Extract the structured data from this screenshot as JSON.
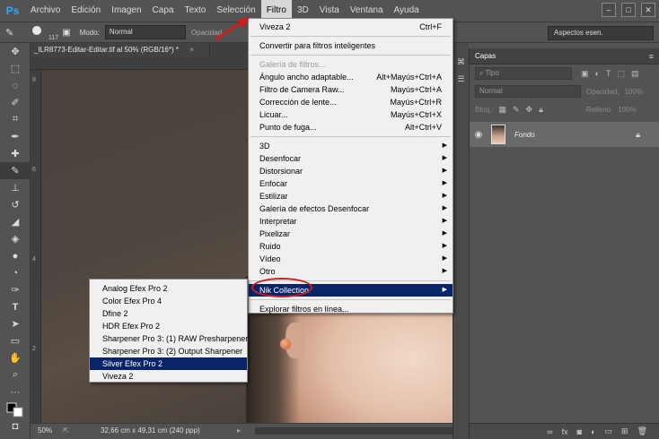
{
  "menubar": {
    "logo": "Ps",
    "items": [
      "Archivo",
      "Edición",
      "Imagen",
      "Capa",
      "Texto",
      "Selección",
      "Filtro",
      "3D",
      "Vista",
      "Ventana",
      "Ayuda"
    ],
    "active": "Filtro"
  },
  "options": {
    "brush_size": "117",
    "mode_label": "Modo:",
    "mode_value": "Normal",
    "opacity_label": "Opacidad",
    "workspace": "Aspectos esen."
  },
  "document": {
    "tab_title": "_ILR8773-Editar-Editar.tif al 50% (RGB/16*) *",
    "close": "×",
    "zoom": "50%",
    "info": "32,66 cm x 49,31 cm (240 ppp)",
    "ruler_marks": [
      "8",
      "6",
      "4",
      "2"
    ]
  },
  "filter_menu": {
    "items": [
      {
        "label": "Viveza 2",
        "shortcut": "Ctrl+F"
      },
      {
        "sep": true
      },
      {
        "label": "Convertir para filtros inteligentes"
      },
      {
        "sep": true
      },
      {
        "label": "Galería de filtros...",
        "disabled": true
      },
      {
        "label": "Ángulo ancho adaptable...",
        "shortcut": "Alt+Mayús+Ctrl+A"
      },
      {
        "label": "Filtro de Camera Raw...",
        "shortcut": "Mayús+Ctrl+A"
      },
      {
        "label": "Corrección de lente...",
        "shortcut": "Mayús+Ctrl+R"
      },
      {
        "label": "Licuar...",
        "shortcut": "Mayús+Ctrl+X"
      },
      {
        "label": "Punto de fuga...",
        "shortcut": "Alt+Ctrl+V"
      },
      {
        "sep": true
      },
      {
        "label": "3D",
        "submenu": true
      },
      {
        "label": "Desenfocar",
        "submenu": true
      },
      {
        "label": "Distorsionar",
        "submenu": true
      },
      {
        "label": "Enfocar",
        "submenu": true
      },
      {
        "label": "Estilizar",
        "submenu": true
      },
      {
        "label": "Galería de efectos Desenfocar",
        "submenu": true
      },
      {
        "label": "Interpretar",
        "submenu": true
      },
      {
        "label": "Pixelizar",
        "submenu": true
      },
      {
        "label": "Ruido",
        "submenu": true
      },
      {
        "label": "Vídeo",
        "submenu": true
      },
      {
        "label": "Otro",
        "submenu": true
      },
      {
        "sep": true
      },
      {
        "label": "Nik Collection",
        "submenu": true,
        "highlighted": true
      },
      {
        "sep": true
      },
      {
        "label": "Explorar filtros en línea..."
      }
    ]
  },
  "nik_submenu": {
    "items": [
      {
        "label": "Analog Efex Pro 2"
      },
      {
        "label": "Color Efex Pro 4"
      },
      {
        "label": "Dfine 2"
      },
      {
        "label": "HDR Efex Pro 2"
      },
      {
        "label": "Sharpener Pro 3: (1) RAW Presharpener"
      },
      {
        "label": "Sharpener Pro 3: (2) Output Sharpener"
      },
      {
        "label": "Silver Efex Pro 2",
        "highlighted": true
      },
      {
        "label": "Viveza 2"
      }
    ]
  },
  "layers_panel": {
    "title": "Capas",
    "kind_label": "Tipo",
    "blend_mode": "Normal",
    "opacity_label": "Opacidad:",
    "opacity_value": "100%",
    "lock_label": "Bloq.:",
    "fill_label": "Relleno:",
    "fill_value": "100%",
    "layer_name": "Fondo",
    "footer_icons": [
      "link-icon",
      "fx-icon",
      "mask-icon",
      "adjustment-icon",
      "folder-icon",
      "new-layer-icon",
      "trash-icon"
    ]
  },
  "colors": {
    "ui_bg": "#535353",
    "menu_bg": "#f0f0f0",
    "highlight": "#0a246a",
    "annotation": "#d01c1c",
    "ps_blue": "#31a8ff"
  }
}
